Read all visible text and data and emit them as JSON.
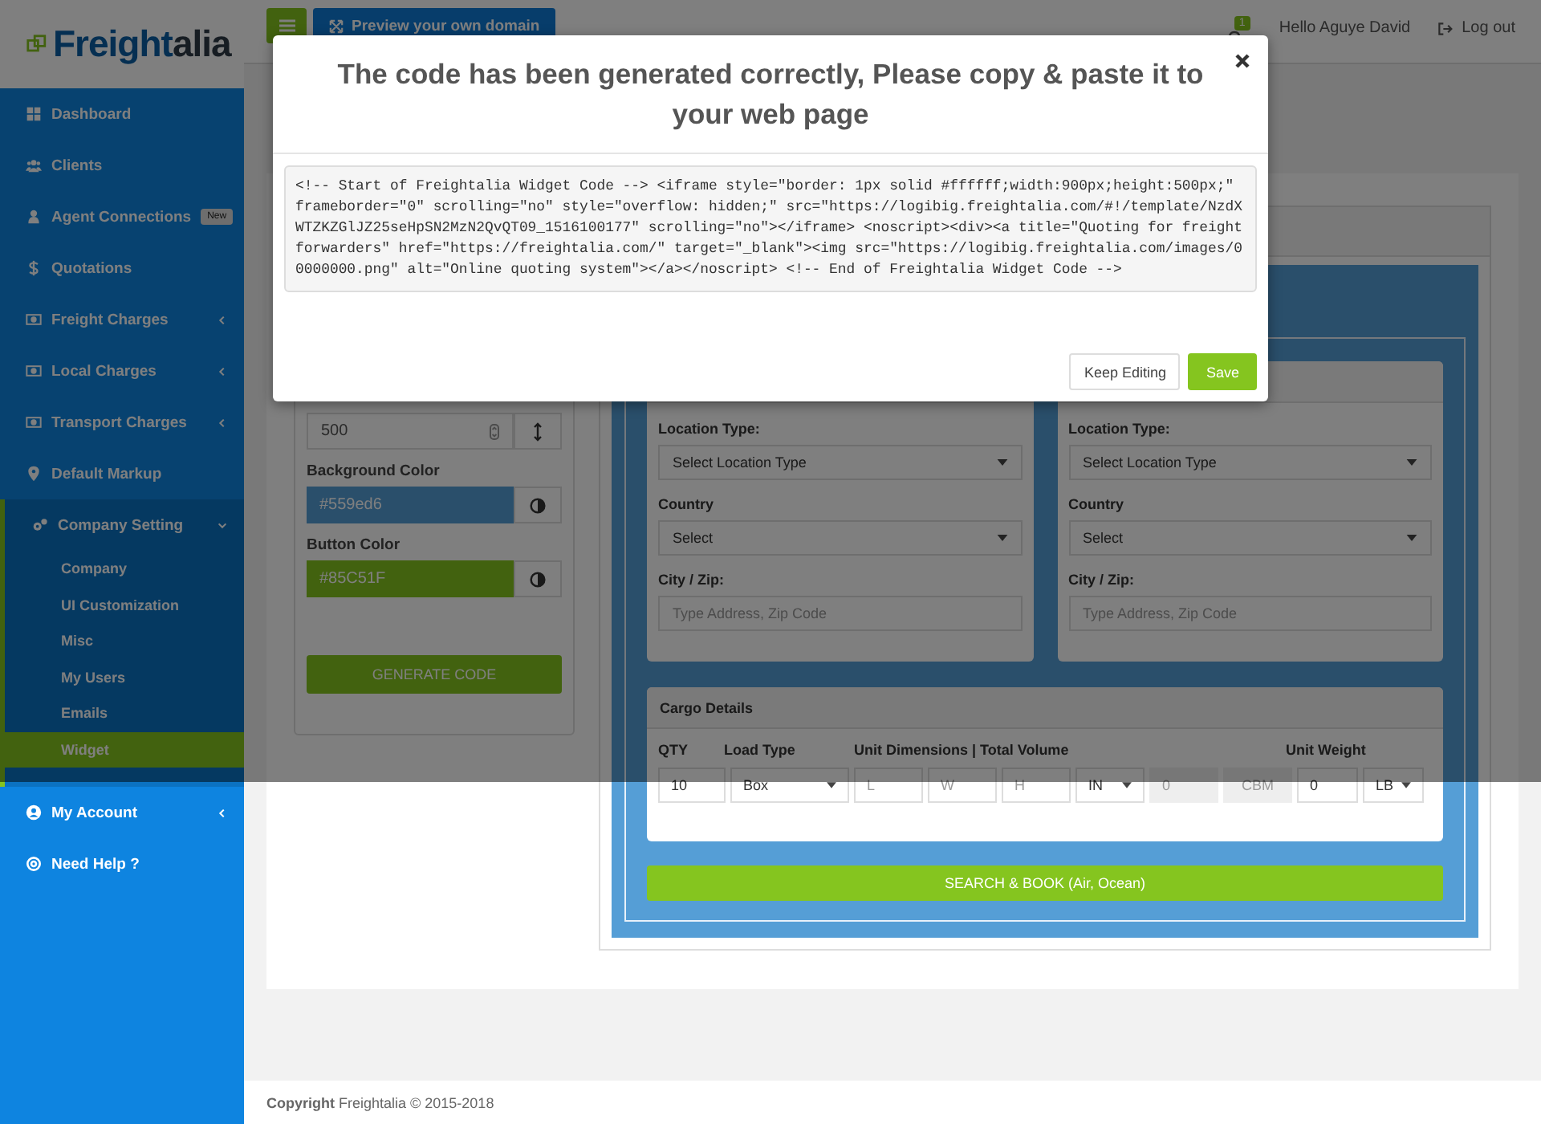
{
  "logo": {
    "text": "Freight",
    "suffix": "alia"
  },
  "sidebar": {
    "items": [
      {
        "label": "Dashboard"
      },
      {
        "label": "Clients"
      },
      {
        "label": "Agent Connections",
        "badge": "New"
      },
      {
        "label": "Quotations"
      },
      {
        "label": "Freight Charges",
        "expanded": false
      },
      {
        "label": "Local Charges",
        "expanded": false
      },
      {
        "label": "Transport Charges",
        "expanded": false
      },
      {
        "label": "Default Markup"
      },
      {
        "label": "Company Setting",
        "expanded": true,
        "children": [
          {
            "label": "Company",
            "selected": false
          },
          {
            "label": "UI Customization",
            "selected": false
          },
          {
            "label": "Misc",
            "selected": false
          },
          {
            "label": "My Users",
            "selected": false
          },
          {
            "label": "Emails",
            "selected": false
          },
          {
            "label": "Widget",
            "selected": true
          }
        ]
      },
      {
        "label": "My Account",
        "expanded": false
      },
      {
        "label": "Need Help ?"
      }
    ]
  },
  "topbar": {
    "preview_button": "Preview your own domain",
    "notification_count": "1",
    "greeting": "Hello Aguye David",
    "logout": "Log out"
  },
  "settings_panel": {
    "height_value": "500",
    "color_fields": [
      {
        "label": "Background Color",
        "value": "#559ed6"
      },
      {
        "label": "Button Color",
        "value": "#85C51F"
      }
    ],
    "generate_button": "GENERATE CODE"
  },
  "preview": {
    "location_panels": [
      {
        "fields": [
          {
            "label": "Location Type:",
            "kind": "select",
            "value": "Select Location Type"
          },
          {
            "label": "Country",
            "kind": "select",
            "value": "Select"
          },
          {
            "label": "City / Zip:",
            "kind": "text",
            "placeholder": "Type Address, Zip Code"
          }
        ]
      },
      {
        "fields": [
          {
            "label": "Location Type:",
            "kind": "select",
            "value": "Select Location Type"
          },
          {
            "label": "Country",
            "kind": "select",
            "value": "Select"
          },
          {
            "label": "City / Zip:",
            "kind": "text",
            "placeholder": "Type Address, Zip Code"
          }
        ]
      }
    ],
    "cargo": {
      "title": "Cargo Details",
      "headers": [
        "QTY",
        "Load Type",
        "Unit Dimensions | Total Volume",
        "Unit Weight"
      ],
      "cells": [
        {
          "kind": "input",
          "value": "10"
        },
        {
          "kind": "select",
          "value": "Box"
        },
        {
          "kind": "input",
          "placeholder": "L"
        },
        {
          "kind": "input",
          "placeholder": "W"
        },
        {
          "kind": "input",
          "placeholder": "H"
        },
        {
          "kind": "select",
          "value": "IN"
        },
        {
          "kind": "readonly",
          "value": "0"
        },
        {
          "kind": "addon",
          "value": "CBM"
        },
        {
          "kind": "input",
          "value": "0"
        },
        {
          "kind": "select",
          "value": "LB"
        }
      ]
    },
    "search_button": "SEARCH & BOOK (Air, Ocean)"
  },
  "modal": {
    "title": "The code has been generated correctly, Please copy & paste it to your web page",
    "code": "<!-- Start of Freightalia Widget Code --> <iframe style=\"border: 1px solid #ffffff;width:900px;height:500px;\" frameborder=\"0\" scrolling=\"no\" style=\"overflow: hidden;\" src=\"https://logibig.freightalia.com/#!/template/NzdXWTZKZGlJZ25seHpSN2MzN2QvQT09_1516100177\" scrolling=\"no\"></iframe> <noscript><div><a title=\"Quoting for freight forwarders\" href=\"https://freightalia.com/\" target=\"_blank\"><img src=\"https://logibig.freightalia.com/images/00000000.png\" alt=\"Online quoting system\"></a></noscript> <!-- End of Freightalia Widget Code -->",
    "buttons": [
      "Keep Editing",
      "Save"
    ]
  },
  "footer": {
    "text": "**Copyright** Freightalia © 2015-2018"
  }
}
